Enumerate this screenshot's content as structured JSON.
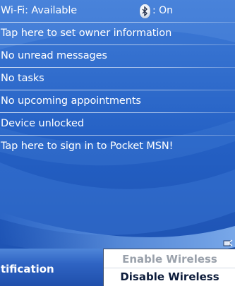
{
  "today": {
    "wifi": {
      "label": "Wi-Fi: Available"
    },
    "bluetooth": {
      "icon": "bluetooth-icon",
      "status": ": On"
    },
    "items": [
      {
        "label": "Tap here to set owner information"
      },
      {
        "label": "No unread messages"
      },
      {
        "label": "No tasks"
      },
      {
        "label": "No upcoming appointments"
      },
      {
        "label": "Device unlocked"
      },
      {
        "label": "Tap here to sign in to Pocket MSN!"
      }
    ]
  },
  "softkey": {
    "left_label": "tification"
  },
  "menu": {
    "items": [
      {
        "label": "Enable Wireless",
        "enabled": false
      },
      {
        "label": "Disable Wireless",
        "enabled": true
      }
    ]
  },
  "colors": {
    "background_dark": "#1d55b8",
    "background_light": "#4f8ae0",
    "text": "#ffffff",
    "menu_disabled": "#9aa1ab",
    "menu_text": "#0c1b3a"
  }
}
